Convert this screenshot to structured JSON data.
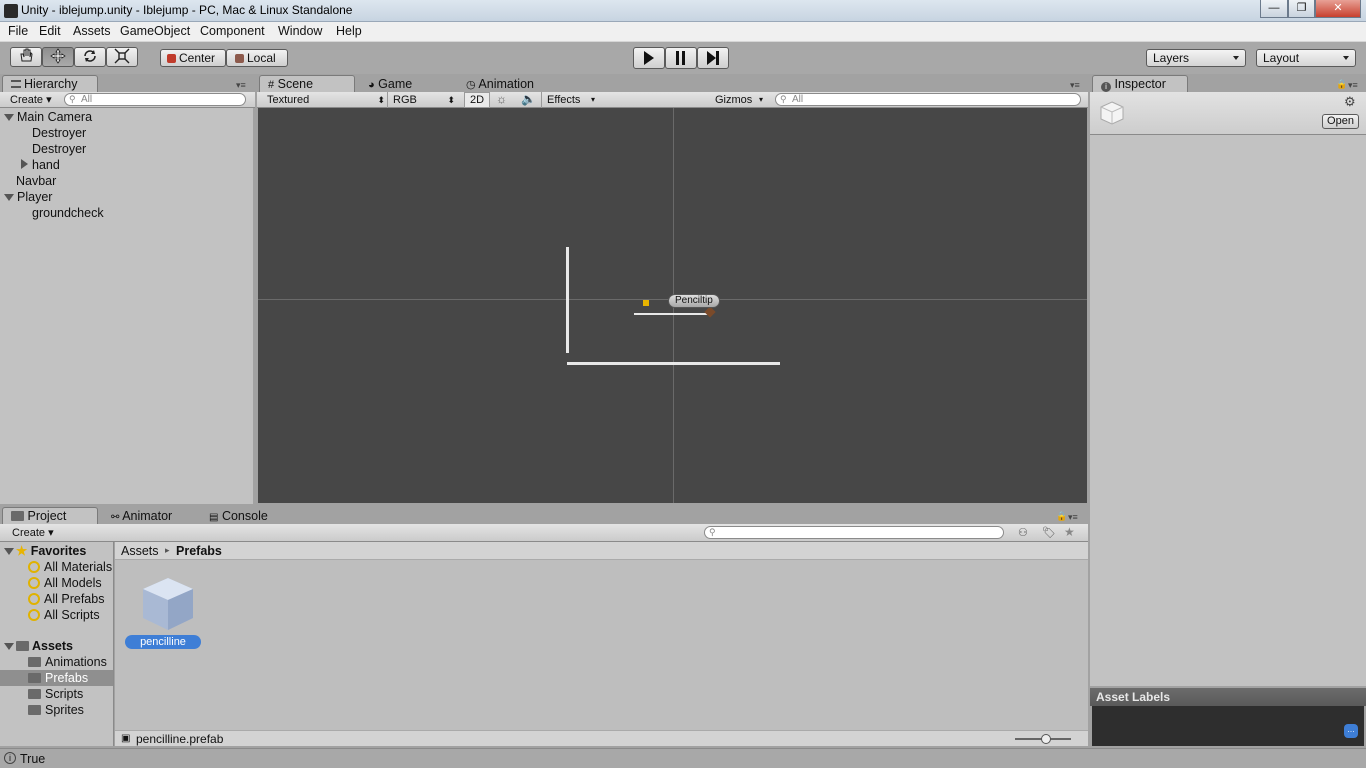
{
  "window": {
    "title": "Unity - iblejump.unity - Iblejump - PC, Mac & Linux Standalone",
    "minimize": "—",
    "maximize": "❐",
    "close": "✕"
  },
  "menu": [
    "File",
    "Edit",
    "Assets",
    "GameObject",
    "Component",
    "Window",
    "Help"
  ],
  "toolbar": {
    "pivot_label": "Center",
    "space_label": "Local",
    "layers_label": "Layers",
    "layout_label": "Layout"
  },
  "hierarchy": {
    "tab_label": "Hierarchy",
    "create_label": "Create",
    "search_placeholder": "All",
    "items": [
      {
        "label": "Main Camera",
        "depth": 0,
        "expand": "open"
      },
      {
        "label": "Destroyer",
        "depth": 1,
        "expand": "none"
      },
      {
        "label": "Destroyer",
        "depth": 1,
        "expand": "none"
      },
      {
        "label": "hand",
        "depth": 1,
        "expand": "closed"
      },
      {
        "label": "Navbar",
        "depth": 0,
        "expand": "none"
      },
      {
        "label": "Player",
        "depth": 0,
        "expand": "open"
      },
      {
        "label": "groundcheck",
        "depth": 1,
        "expand": "none"
      }
    ]
  },
  "scene": {
    "tabs": [
      "Scene",
      "Game",
      "Animation"
    ],
    "render_mode": "Textured",
    "color_mode": "RGB",
    "mode_2d": "2D",
    "effects_label": "Effects",
    "gizmos_label": "Gizmos",
    "search_placeholder": "All",
    "object_label": "Penciltip",
    "background_color": "#474747"
  },
  "inspector": {
    "tab_label": "Inspector",
    "open_button": "Open",
    "asset_labels_title": "Asset Labels"
  },
  "project": {
    "tabs": [
      "Project",
      "Animator",
      "Console"
    ],
    "create_label": "Create",
    "favorites_label": "Favorites",
    "favorites": [
      "All Materials",
      "All Models",
      "All Prefabs",
      "All Scripts"
    ],
    "assets_label": "Assets",
    "folders": [
      "Animations",
      "Prefabs",
      "Scripts",
      "Sprites"
    ],
    "selected_folder": "Prefabs",
    "breadcrumb": [
      "Assets",
      "Prefabs"
    ],
    "asset_name": "pencilline",
    "selected_file": "pencilline.prefab",
    "accent": "#3e7ed6"
  },
  "status": {
    "text": "True"
  }
}
